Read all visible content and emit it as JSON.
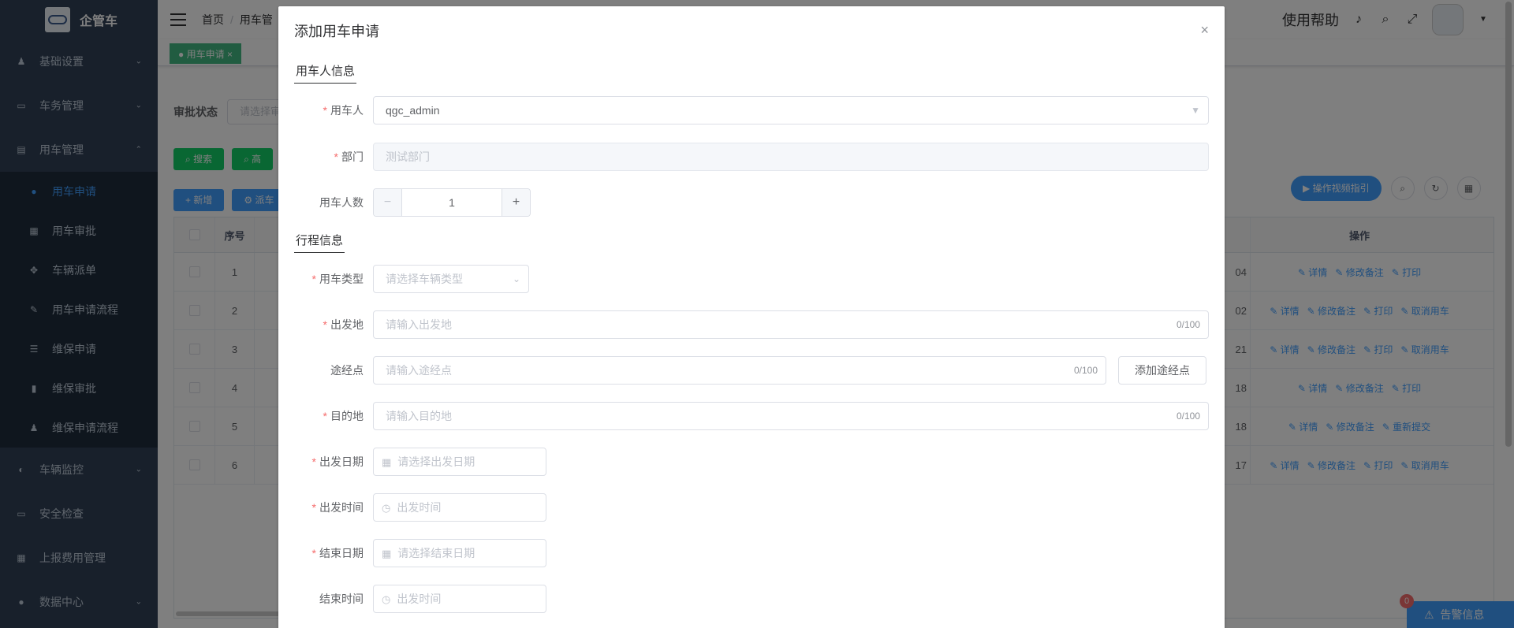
{
  "app": {
    "name": "企管车"
  },
  "sidebar": {
    "items": [
      {
        "label": "基础设置",
        "icon": "user-group-icon"
      },
      {
        "label": "车务管理",
        "icon": "monitor-icon"
      },
      {
        "label": "用车管理",
        "icon": "document-icon"
      }
    ],
    "subitems": [
      {
        "label": "用车申请",
        "icon": "user-icon",
        "active": true
      },
      {
        "label": "用车审批",
        "icon": "form-icon"
      },
      {
        "label": "车辆派单",
        "icon": "move-icon"
      },
      {
        "label": "用车申请流程",
        "icon": "edit-icon"
      },
      {
        "label": "维保申请",
        "icon": "list-icon"
      },
      {
        "label": "维保审批",
        "icon": "chart-icon"
      },
      {
        "label": "维保申请流程",
        "icon": "people-icon"
      }
    ],
    "items_after": [
      {
        "label": "车辆监控",
        "icon": "globe-icon"
      },
      {
        "label": "安全检查",
        "icon": "monitor-icon"
      },
      {
        "label": "上报费用管理",
        "icon": "table-icon"
      },
      {
        "label": "数据中心",
        "icon": "lock-icon"
      }
    ]
  },
  "navbar": {
    "breadcrumb": [
      "首页",
      "用车管"
    ],
    "help": "使用帮助"
  },
  "tags": {
    "active": "用车申请"
  },
  "filter": {
    "label": "审批状态",
    "placeholder": "请选择审"
  },
  "toolbar": {
    "search": "搜索",
    "reset": "高",
    "add": "新增",
    "add_icon": "+",
    "other": "派车",
    "video": "操作视频指引"
  },
  "table": {
    "headers": {
      "index": "序号",
      "ops": "操作"
    },
    "rows": [
      {
        "index": "1",
        "tail": "04",
        "ops": [
          "详情",
          "修改备注",
          "打印"
        ]
      },
      {
        "index": "2",
        "tail": "02",
        "ops": [
          "详情",
          "修改备注",
          "打印",
          "取消用车"
        ]
      },
      {
        "index": "3",
        "tail": "21",
        "ops": [
          "详情",
          "修改备注",
          "打印",
          "取消用车"
        ]
      },
      {
        "index": "4",
        "tail": "18",
        "ops": [
          "详情",
          "修改备注",
          "打印"
        ]
      },
      {
        "index": "5",
        "tail": "18",
        "ops": [
          "详情",
          "修改备注",
          "重新提交"
        ]
      },
      {
        "index": "6",
        "tail": "17",
        "ops": [
          "详情",
          "修改备注",
          "打印",
          "取消用车"
        ]
      }
    ]
  },
  "alarm": {
    "label": "告警信息",
    "count": "0"
  },
  "dialog": {
    "title": "添加用车申请",
    "close": "×",
    "section1": "用车人信息",
    "section2": "行程信息",
    "fields": {
      "user": {
        "label": "用车人",
        "value": "qgc_admin"
      },
      "dept": {
        "label": "部门",
        "placeholder": "测试部门"
      },
      "count": {
        "label": "用车人数",
        "value": "1"
      },
      "type": {
        "label": "用车类型",
        "placeholder": "请选择车辆类型"
      },
      "origin": {
        "label": "出发地",
        "placeholder": "请输入出发地",
        "counter": "0/100"
      },
      "waypoint": {
        "label": "途经点",
        "placeholder": "请输入途经点",
        "counter": "0/100",
        "button": "添加途经点"
      },
      "dest": {
        "label": "目的地",
        "placeholder": "请输入目的地",
        "counter": "0/100"
      },
      "start_date": {
        "label": "出发日期",
        "placeholder": "请选择出发日期"
      },
      "start_time": {
        "label": "出发时间",
        "placeholder": "出发时间"
      },
      "end_date": {
        "label": "结束日期",
        "placeholder": "请选择结束日期"
      },
      "end_time": {
        "label": "结束时间",
        "placeholder": "出发时间"
      }
    }
  },
  "colors": {
    "sidebar_bg": "#304156",
    "accent": "#409eff",
    "success": "#13ce66",
    "required": "#f56c6c"
  }
}
